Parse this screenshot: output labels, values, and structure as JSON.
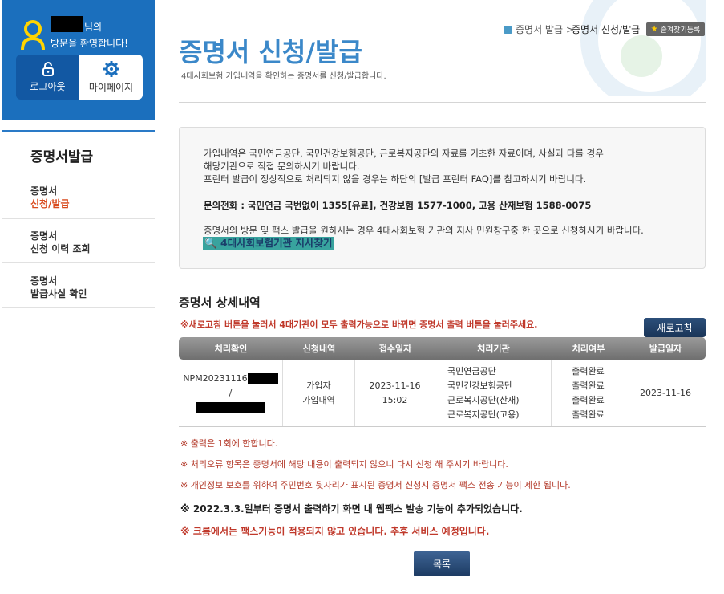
{
  "user": {
    "name_suffix": "님의",
    "welcome": "방문을 환영합니다!",
    "logout_label": "로그아웃",
    "mypage_label": "마이페이지"
  },
  "nav": {
    "title": "증명서발급",
    "items": [
      {
        "line1": "증명서",
        "line2": "신청/발급",
        "active": true
      },
      {
        "line1": "증명서",
        "line2": "신청 이력 조회",
        "active": false
      },
      {
        "line1": "증명서",
        "line2": "발급사실 확인",
        "active": false
      }
    ]
  },
  "header": {
    "title": "증명서 신청/발급",
    "subtitle": "4대사회보험 가입내역을 확인하는 증명서를 신청/발급합니다.",
    "breadcrumb_home": "증명서 발급",
    "breadcrumb_sep": ">",
    "breadcrumb_current": "증명서 신청/발급",
    "favorite_label": "즐겨찾기등록"
  },
  "info": {
    "line1": "가입내역은 국민연금공단, 국민건강보험공단, 근로복지공단의 자료를 기초한 자료이며, 사실과 다를 경우",
    "line2": "해당기관으로 직접 문의하시기 바랍니다.",
    "line3": "프린터 발급이 정상적으로 처리되지 않을 경우는 하단의 [발급 프린터 FAQ]를 참고하시기 바랍니다.",
    "phone": "문의전화 : 국민연금 국번없이 1355[유료], 건강보험 1577-1000, 고용 산재보험 1588-0075",
    "line4": "증명서의 방문 및 팩스 발급을 원하시는 경우 4대사회보험 기관의 지사 민원창구중 한 곳으로 신청하시기 바랍니다.",
    "branch_link": "4대사회보험기관 지사찾기"
  },
  "detail": {
    "title": "증명서 상세내역",
    "warning": "※새로고침 버튼을 눌러서 4대기관이 모두 출력가능으로 바뀌면 증명서 출력 버튼을 눌러주세요.",
    "refresh_label": "새로고침",
    "headers": [
      "처리확인",
      "신청내역",
      "접수일자",
      "처리기관",
      "처리여부",
      "발급일자"
    ],
    "row": {
      "id_prefix": "NPM20231116",
      "id_sep": "/",
      "request": [
        "가입자",
        "가입내역"
      ],
      "received": [
        "2023-11-16",
        "15:02"
      ],
      "agencies": [
        "국민연금공단",
        "국민건강보험공단",
        "근로복지공단(산재)",
        "근로복지공단(고용)"
      ],
      "status": [
        "출력완료",
        "출력완료",
        "출력완료",
        "출력완료"
      ],
      "issued": "2023-11-16"
    }
  },
  "notes": {
    "n1": "※ 출력은 1회에 한합니다.",
    "n2": "※ 처리오류 항목은 증명서에 해당 내용이 출력되지 않으니 다시 신청 해 주시기 바랍니다.",
    "n3": "※ 개인정보 보호를 위하여 주민번호 뒷자리가 표시된 증명서 신청시 증명서 팩스 전송 기능이 제한 됩니다.",
    "n4": "※ 2022.3.3.일부터 증명서 출력하기 화면 내 웹팩스 발송 기능이 추가되었습니다.",
    "n5": "※ 크롬에서는 팩스기능이 적용되지 않고 있습니다. 추후 서비스 예정입니다."
  },
  "list_label": "목록",
  "colors": {
    "accent": "#3b88c9",
    "panel": "#1b6fbd",
    "warn": "#c0392b"
  }
}
